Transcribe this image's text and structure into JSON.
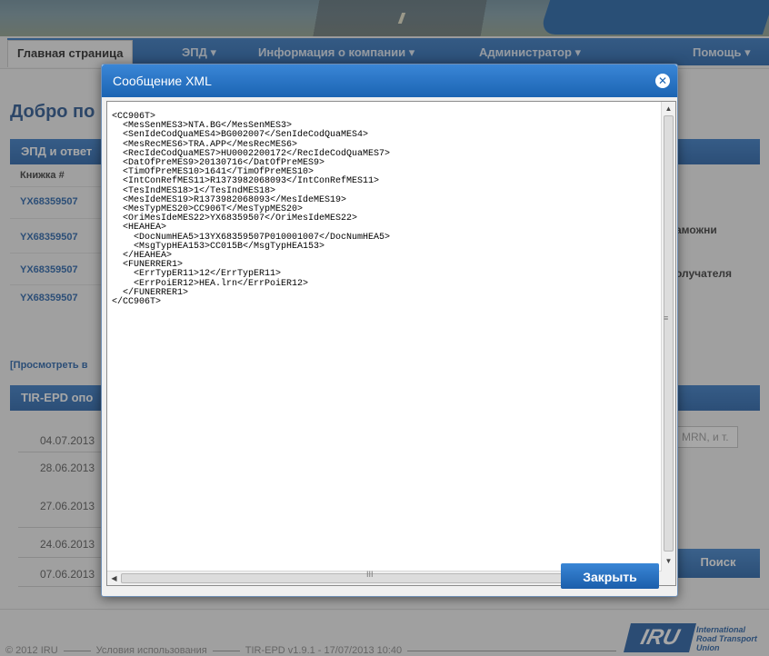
{
  "nav": {
    "home": "Главная страница",
    "epd": "ЭПД ▾",
    "company": "Информация о компании ▾",
    "admin": "Администратор ▾",
    "help": "Помощь ▾"
  },
  "page": {
    "welcome": "Добро по",
    "panel1_title": "ЭПД и ответ",
    "col_book": "Книжка #",
    "rows": [
      "YX68359507",
      "YX68359507",
      "YX68359507",
      "YX68359507"
    ],
    "view_link": "[Просмотреть в",
    "panel2_title": "TIR-EPD опо",
    "dates": [
      "04.07.2013",
      "28.06.2013",
      "27.06.2013",
      "24.06.2013",
      "07.06.2013"
    ],
    "right_text_1": "аможни",
    "right_text_2": "олучателя",
    "right_input_placeholder": "MRN, и т.",
    "search_button": "Поиск"
  },
  "dialog": {
    "title": "Сообщение XML",
    "close_button": "Закрыть",
    "xml_lines": [
      "<CC906T>",
      "  <MesSenMES3>NTA.BG</MesSenMES3>",
      "  <SenIdeCodQuaMES4>BG002007</SenIdeCodQuaMES4>",
      "  <MesRecMES6>TRA.APP</MesRecMES6>",
      "  <RecIdeCodQuaMES7>HU0002200172</RecIdeCodQuaMES7>",
      "  <DatOfPreMES9>20130716</DatOfPreMES9>",
      "  <TimOfPreMES10>1641</TimOfPreMES10>",
      "  <IntConRefMES11>R1373982068093</IntConRefMES11>",
      "  <TesIndMES18>1</TesIndMES18>",
      "  <MesIdeMES19>R1373982068093</MesIdeMES19>",
      "  <MesTypMES20>CC906T</MesTypMES20>",
      "  <OriMesIdeMES22>YX68359507</OriMesIdeMES22>",
      "  <HEAHEA>",
      "    <DocNumHEA5>13YX68359507P010001007</DocNumHEA5>",
      "    <MsgTypHEA153>CC015B</MsgTypHEA153>",
      "  </HEAHEA>",
      "  <FUNERRER1>",
      "    <ErrTypER11>12</ErrTypER11>",
      "    <ErrPoiER12>HEA.lrn</ErrPoiER12>",
      "  </FUNERRER1>",
      "</CC906T>"
    ]
  },
  "footer": {
    "copyright": "© 2012 IRU",
    "terms": "Условия использования",
    "version": "TIR-EPD v1.9.1 - 17/07/2013 10:40",
    "iru_logo": "IRU",
    "iru_line1": "International",
    "iru_line2": "Road Transport",
    "iru_line3": "Union"
  },
  "colors": {
    "accent": "#1b64b3",
    "overlay": "rgba(60,60,60,0.45)"
  }
}
